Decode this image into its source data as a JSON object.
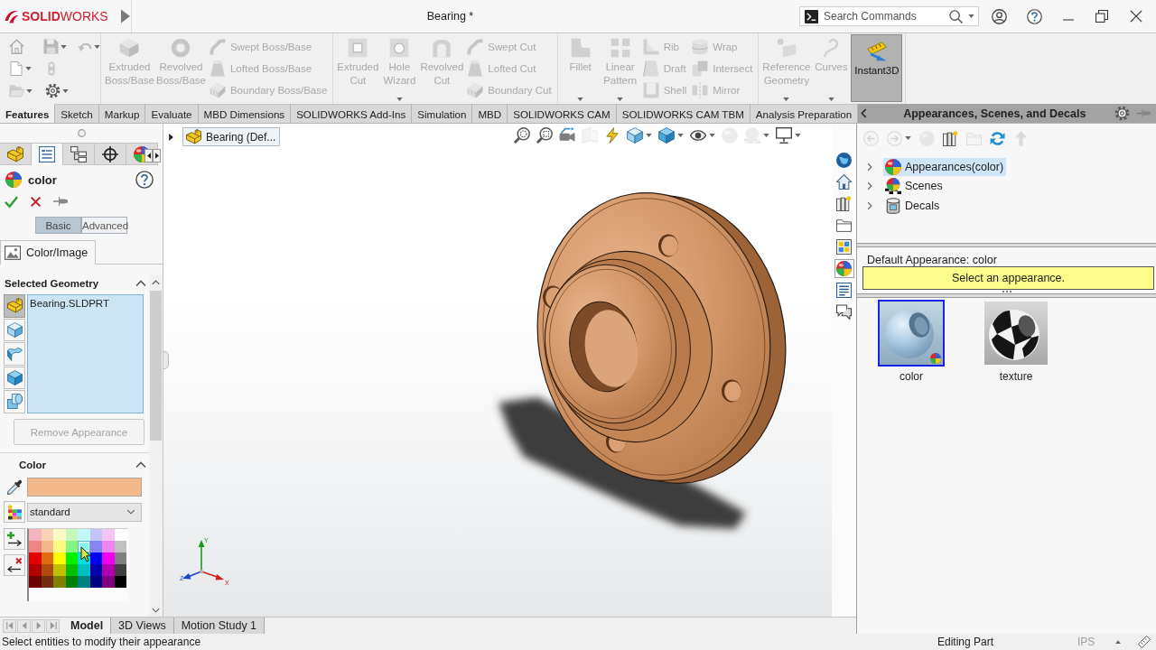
{
  "title_bar": {
    "logo": "**SOLID**WORKS",
    "document_title": "Bearing *",
    "search": {
      "placeholder": "Search Commands"
    }
  },
  "ribbon": {
    "groups": [
      {
        "columns": [
          {
            "kind": "large",
            "label": "Extruded Boss/Base",
            "disabled": true,
            "on": false,
            "dropdown": false
          },
          {
            "kind": "large",
            "label": "Revolved Boss/Base",
            "disabled": true,
            "on": false,
            "dropdown": false
          },
          {
            "kind": "stack",
            "items": [
              {
                "label": "Swept Boss/Base",
                "disabled": true
              },
              {
                "label": "Lofted Boss/Base",
                "disabled": true
              },
              {
                "label": "Boundary Boss/Base",
                "disabled": true
              }
            ]
          }
        ]
      },
      {
        "columns": [
          {
            "kind": "large",
            "label": "Extruded Cut",
            "disabled": true,
            "on": false,
            "dropdown": false
          },
          {
            "kind": "large",
            "label": "Hole Wizard",
            "disabled": true,
            "on": false,
            "dropdown": true
          },
          {
            "kind": "large",
            "label": "Revolved Cut",
            "disabled": true,
            "on": false,
            "dropdown": false
          },
          {
            "kind": "stack",
            "items": [
              {
                "label": "Swept Cut",
                "disabled": true
              },
              {
                "label": "Lofted Cut",
                "disabled": true
              },
              {
                "label": "Boundary Cut",
                "disabled": true
              }
            ]
          }
        ]
      },
      {
        "columns": [
          {
            "kind": "large",
            "label": "Fillet",
            "disabled": true,
            "on": false,
            "dropdown": true
          },
          {
            "kind": "large",
            "label": "Linear Pattern",
            "disabled": true,
            "on": false,
            "dropdown": true
          },
          {
            "kind": "stack",
            "items": [
              {
                "label": "Rib",
                "disabled": true
              },
              {
                "label": "Draft",
                "disabled": true
              },
              {
                "label": "Shell",
                "disabled": true
              }
            ]
          },
          {
            "kind": "stack",
            "items": [
              {
                "label": "Wrap",
                "disabled": true
              },
              {
                "label": "Intersect",
                "disabled": true
              },
              {
                "label": "Mirror",
                "disabled": true
              }
            ]
          }
        ]
      },
      {
        "columns": [
          {
            "kind": "large",
            "label": "Reference Geometry",
            "disabled": true,
            "on": false,
            "dropdown": true
          },
          {
            "kind": "large",
            "label": "Curves",
            "disabled": true,
            "on": false,
            "dropdown": true
          },
          {
            "kind": "large",
            "label": "Instant3D",
            "disabled": false,
            "on": true,
            "dropdown": false
          }
        ]
      }
    ]
  },
  "command_tabs": [
    {
      "label": "Features",
      "selected": true
    },
    {
      "label": "Sketch",
      "selected": false
    },
    {
      "label": "Markup",
      "selected": false
    },
    {
      "label": "Evaluate",
      "selected": false
    },
    {
      "label": "MBD Dimensions",
      "selected": false
    },
    {
      "label": "SOLIDWORKS Add-Ins",
      "selected": false
    },
    {
      "label": "Simulation",
      "selected": false
    },
    {
      "label": "MBD",
      "selected": false
    },
    {
      "label": "SOLIDWORKS CAM",
      "selected": false
    },
    {
      "label": "SOLIDWORKS CAM TBM",
      "selected": false
    },
    {
      "label": "Analysis Preparation",
      "selected": false
    }
  ],
  "property_manager": {
    "tabs": [
      {
        "selected": false
      },
      {
        "selected": true
      },
      {
        "selected": false
      },
      {
        "selected": false
      },
      {
        "selected": false
      }
    ],
    "title": "color",
    "modes": [
      {
        "label": "Basic",
        "selected": true
      },
      {
        "label": "Advanced",
        "selected": false
      }
    ],
    "sub_tab": "Color/Image",
    "selected_geometry": {
      "title": "Selected Geometry",
      "expanded": true,
      "filters": [
        {
          "selected": true
        },
        {
          "selected": false
        },
        {
          "selected": false
        },
        {
          "selected": false
        },
        {
          "selected": false
        }
      ],
      "items": [
        "Bearing.SLDPRT"
      ],
      "remove_button": {
        "label": "Remove Appearance",
        "disabled": true
      }
    },
    "color": {
      "title": "Color",
      "expanded": true,
      "palette_name": "standard",
      "palette": [
        {
          "color": "#f4b4bc",
          "selected": false
        },
        {
          "color": "#f8d4b4",
          "selected": false
        },
        {
          "color": "#fafac4",
          "selected": false
        },
        {
          "color": "#c4f8bc",
          "selected": false
        },
        {
          "color": "#c4f8f8",
          "selected": false
        },
        {
          "color": "#c4c4f8",
          "selected": false
        },
        {
          "color": "#f4c4f4",
          "selected": false
        },
        {
          "color": "#ffffff",
          "selected": false
        },
        {
          "color": "#f08484",
          "selected": false
        },
        {
          "color": "#f4b888",
          "selected": false
        },
        {
          "color": "#fcfc84",
          "selected": false
        },
        {
          "color": "#84f484",
          "selected": false
        },
        {
          "color": "#84f4f4",
          "selected": true
        },
        {
          "color": "#8484f4",
          "selected": false
        },
        {
          "color": "#f084f0",
          "selected": false
        },
        {
          "color": "#c0c0c0",
          "selected": false
        },
        {
          "color": "#e00000",
          "selected": false
        },
        {
          "color": "#e06c10",
          "selected": false
        },
        {
          "color": "#fcfc00",
          "selected": false
        },
        {
          "color": "#00f000",
          "selected": false
        },
        {
          "color": "#00e0e0",
          "selected": false
        },
        {
          "color": "#0000f0",
          "selected": false
        },
        {
          "color": "#f000f0",
          "selected": false
        },
        {
          "color": "#808080",
          "selected": false
        },
        {
          "color": "#b00000",
          "selected": false
        },
        {
          "color": "#b04c10",
          "selected": false
        },
        {
          "color": "#c0c000",
          "selected": false
        },
        {
          "color": "#00c000",
          "selected": false
        },
        {
          "color": "#00c0c0",
          "selected": false
        },
        {
          "color": "#0000b0",
          "selected": false
        },
        {
          "color": "#b000b0",
          "selected": false
        },
        {
          "color": "#404040",
          "selected": false
        },
        {
          "color": "#700000",
          "selected": false
        },
        {
          "color": "#703010",
          "selected": false
        },
        {
          "color": "#808000",
          "selected": false
        },
        {
          "color": "#008000",
          "selected": false
        },
        {
          "color": "#008080",
          "selected": false
        },
        {
          "color": "#000080",
          "selected": false
        },
        {
          "color": "#800080",
          "selected": false
        },
        {
          "color": "#000000",
          "selected": false
        }
      ]
    }
  },
  "viewport": {
    "tree_flyout": {
      "label": "Bearing (Def...",
      "expanded": false
    },
    "heads_up_toolbar": [
      {
        "disabled": false,
        "dropdown": false
      },
      {
        "disabled": false,
        "dropdown": false
      },
      {
        "disabled": false,
        "dropdown": false
      },
      {
        "disabled": true,
        "dropdown": false
      },
      {
        "disabled": false,
        "dropdown": false
      },
      {
        "disabled": false,
        "dropdown": true
      },
      {
        "disabled": false,
        "dropdown": true
      },
      {
        "disabled": false,
        "dropdown": true
      },
      {
        "disabled": true,
        "dropdown": false
      },
      {
        "disabled": true,
        "dropdown": true
      },
      {
        "disabled": false,
        "dropdown": true
      }
    ],
    "triad_labels": [
      "Y",
      "X",
      "Z"
    ]
  },
  "task_tabs": [
    {
      "selected": false
    },
    {
      "selected": false
    },
    {
      "selected": false
    },
    {
      "selected": false
    },
    {
      "selected": false
    },
    {
      "selected": true
    },
    {
      "selected": false
    },
    {
      "selected": false
    }
  ],
  "task_pane": {
    "title": "Appearances, Scenes, and Decals",
    "nav": [
      {
        "disabled": true,
        "dropdown": false
      },
      {
        "disabled": true,
        "dropdown": true
      },
      {
        "disabled": true,
        "dropdown": false
      },
      {
        "disabled": false,
        "dropdown": false
      },
      {
        "disabled": true,
        "dropdown": false
      },
      {
        "disabled": false,
        "dropdown": false
      },
      {
        "disabled": true,
        "dropdown": false
      }
    ],
    "tree": [
      {
        "label": "Appearances(color)",
        "selected": true,
        "expanded": false
      },
      {
        "label": "Scenes",
        "selected": false,
        "expanded": false
      },
      {
        "label": "Decals",
        "selected": false,
        "expanded": false
      }
    ],
    "default_appearance": "Default Appearance: color",
    "message": "Select an appearance.",
    "appearances": [
      {
        "label": "color",
        "selected": true
      },
      {
        "label": "texture",
        "selected": false
      }
    ]
  },
  "bottom_tabs": [
    {
      "label": "Model",
      "selected": true
    },
    {
      "label": "3D Views",
      "selected": false
    },
    {
      "label": "Motion Study 1",
      "selected": false
    }
  ],
  "status_bar": {
    "message": "Select entities to modify their appearance",
    "mode": "Editing Part",
    "units": "IPS"
  }
}
